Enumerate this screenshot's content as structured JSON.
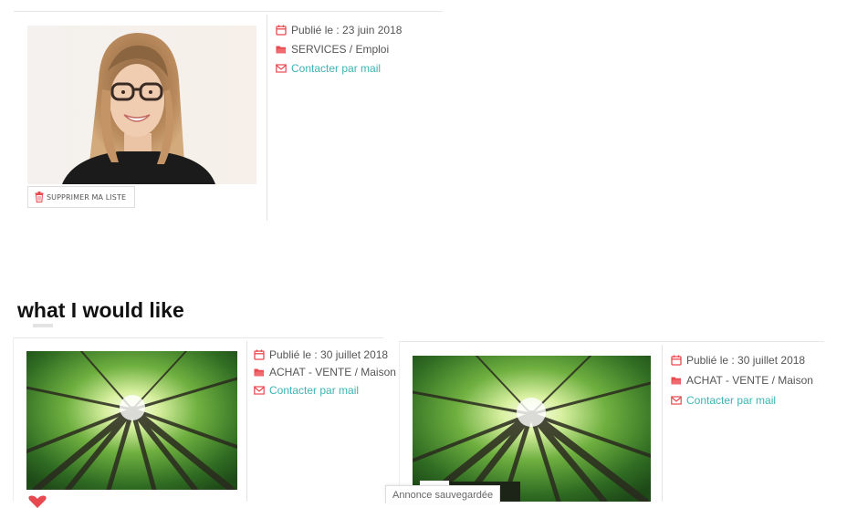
{
  "top_card": {
    "delete_label": "SUPPRIMER MA LISTE",
    "published": "Publié le : 23 juin 2018",
    "category": "SERVICES / Emploi",
    "contact": "Contacter par mail"
  },
  "heading": "what I would like",
  "card_left": {
    "published": "Publié le : 30 juillet 2018",
    "category": "ACHAT - VENTE / Maison",
    "contact": "Contacter par mail"
  },
  "card_right": {
    "published": "Publié le : 30 juillet 2018",
    "category": "ACHAT - VENTE / Maison",
    "contact": "Contacter par mail"
  },
  "toast": "Annonce sauvegardée",
  "colors": {
    "icon_red": "#e8484f",
    "link_teal": "#3fb3b3",
    "heart": "#e8484f"
  },
  "icons": {
    "calendar": "calendar-icon",
    "folder": "folder-icon",
    "mail": "envelope-icon",
    "trash": "trash-icon",
    "heart": "heart-icon"
  }
}
